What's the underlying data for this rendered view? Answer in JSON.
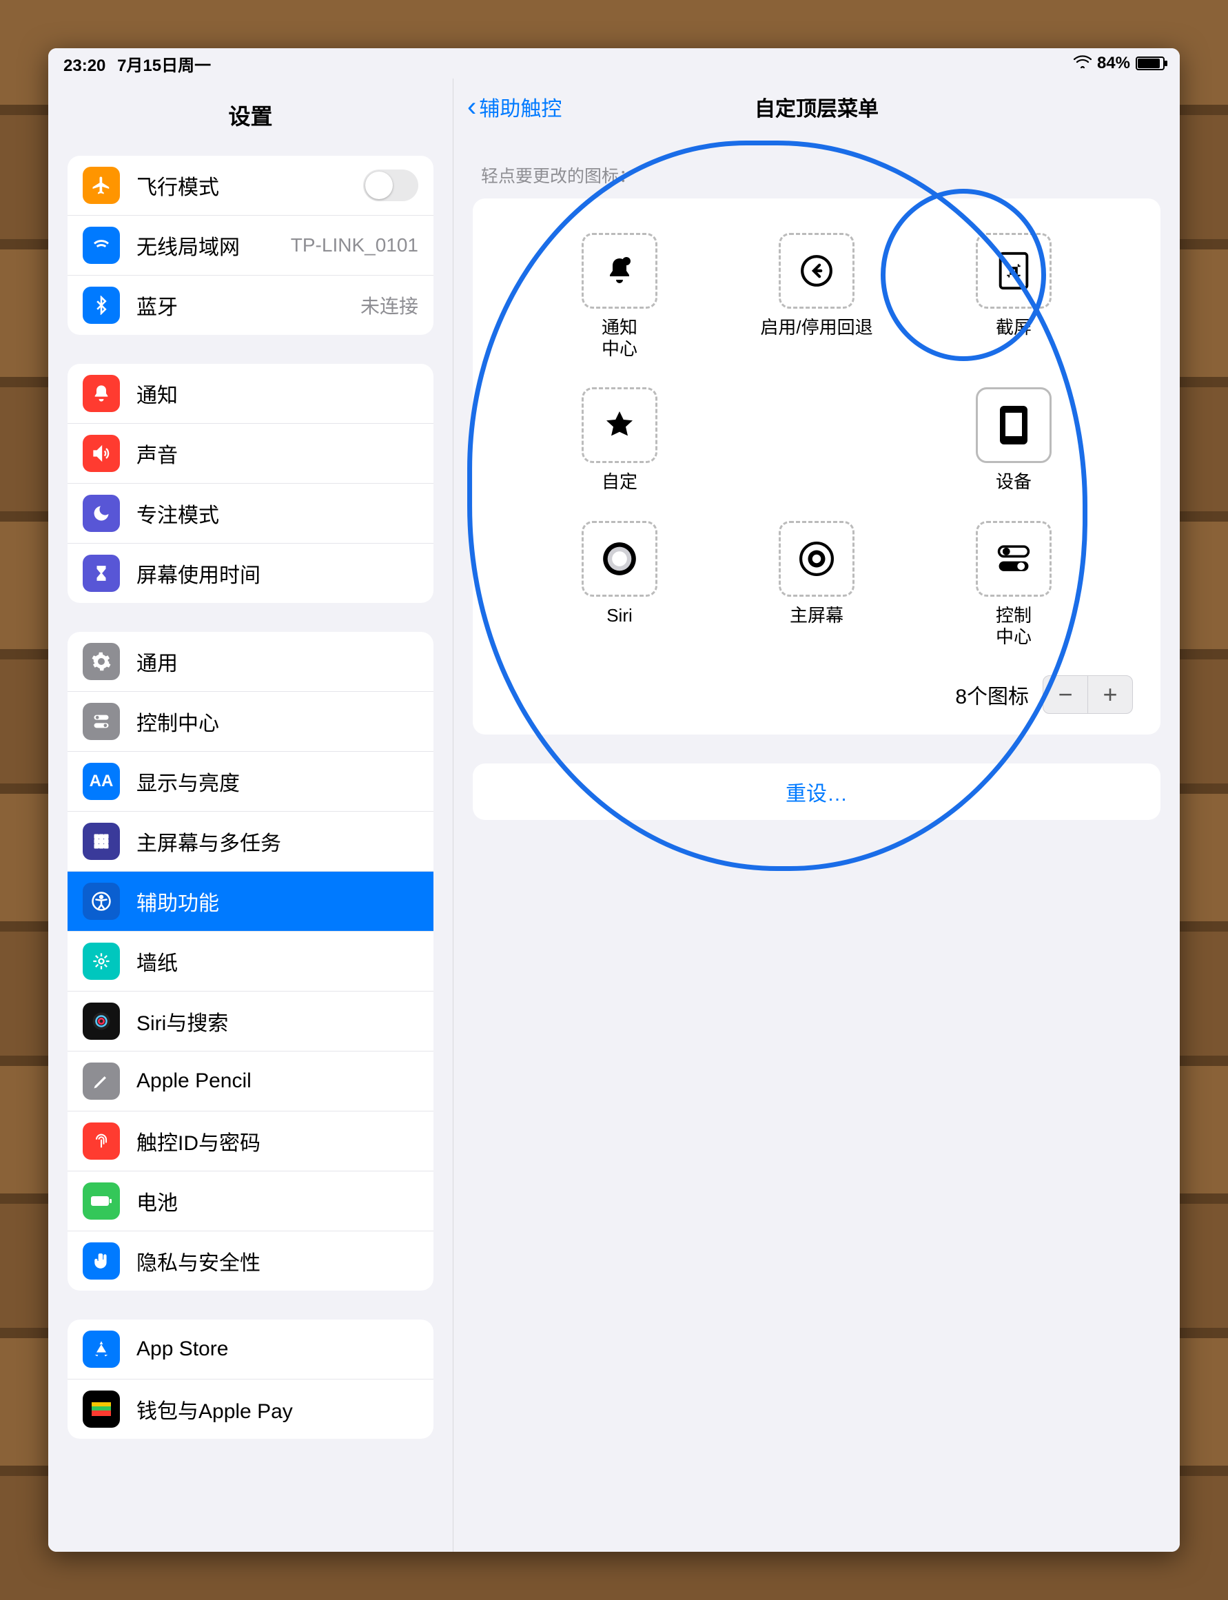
{
  "statusbar": {
    "time": "23:20",
    "date": "7月15日周一",
    "battery_pct": "84%"
  },
  "sidebar": {
    "title": "设置",
    "airplane": "飞行模式",
    "wifi": "无线局域网",
    "wifi_value": "TP-LINK_0101",
    "bluetooth": "蓝牙",
    "bluetooth_value": "未连接",
    "notifications": "通知",
    "sound": "声音",
    "focus": "专注模式",
    "screentime": "屏幕使用时间",
    "general": "通用",
    "control_center": "控制中心",
    "display": "显示与亮度",
    "homescreen": "主屏幕与多任务",
    "accessibility": "辅助功能",
    "wallpaper": "墙纸",
    "siri": "Siri与搜索",
    "pencil": "Apple Pencil",
    "touchid": "触控ID与密码",
    "battery": "电池",
    "privacy": "隐私与安全性",
    "appstore": "App Store",
    "wallet": "钱包与Apple Pay"
  },
  "main": {
    "back": "辅助触控",
    "title": "自定顶层菜单",
    "hint": "轻点要更改的图标：",
    "items": {
      "notif_center": "通知\n中心",
      "back_toggle": "启用/停用回退",
      "screenshot": "截屏",
      "custom": "自定",
      "device": "设备",
      "siri": "Siri",
      "home": "主屏幕",
      "control_center": "控制\n中心"
    },
    "count": "8个图标",
    "reset": "重设…"
  }
}
